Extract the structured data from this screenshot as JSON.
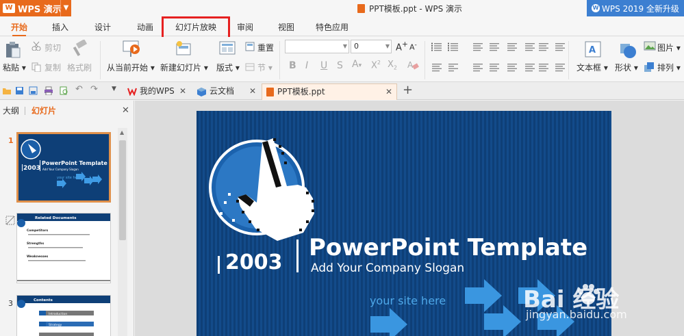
{
  "titlebar": {
    "app_label": "WPS 演示",
    "doc_title": "PPT模板.ppt - WPS 演示",
    "upgrade_label": "WPS 2019 全新升级"
  },
  "tabs": [
    "开始",
    "插入",
    "设计",
    "动画",
    "幻灯片放映",
    "审阅",
    "视图",
    "特色应用"
  ],
  "active_tab": "开始",
  "ribbon": {
    "paste": "粘贴",
    "cut": "剪切",
    "copy": "复制",
    "format_painter": "格式刷",
    "from_current": "从当前开始",
    "new_slide": "新建幻灯片",
    "layout": "版式",
    "reset": "重置",
    "section": "节",
    "font_size": "0",
    "textbox": "文本框",
    "shape": "形状",
    "arrange": "排列",
    "picture": "图片"
  },
  "doc_tabs": [
    {
      "label": "我的WPS"
    },
    {
      "label": "云文档"
    },
    {
      "label": "PPT模板.ppt"
    }
  ],
  "left_panel": {
    "outline_tab": "大纲",
    "slides_tab": "幻灯片",
    "slide_numbers": [
      "1",
      "3"
    ]
  },
  "thumbs": {
    "t1_title": "PowerPoint Template",
    "t1_sub": "Add Your Company Slogan",
    "t1_year": "2003",
    "t1_site": "your site here",
    "t2_title": "Related Documents",
    "t2_items": [
      "Competitors",
      "Strengths",
      "Weaknesses"
    ],
    "t3_title": "Contents",
    "t3_items": [
      "Introduction",
      "Strategy"
    ]
  },
  "slide": {
    "title": "PowerPoint Template",
    "slogan": "Add Your Company Slogan",
    "year": "2003",
    "site": "your site here"
  },
  "watermark": {
    "brand": "Bai 经验",
    "url": "jingyan.baidu.com"
  },
  "colors": {
    "accent": "#e86a1c",
    "upgrade_blue": "#3c7fd1",
    "slide_blue": "#0e3f77",
    "highlight_red": "#e62020"
  }
}
